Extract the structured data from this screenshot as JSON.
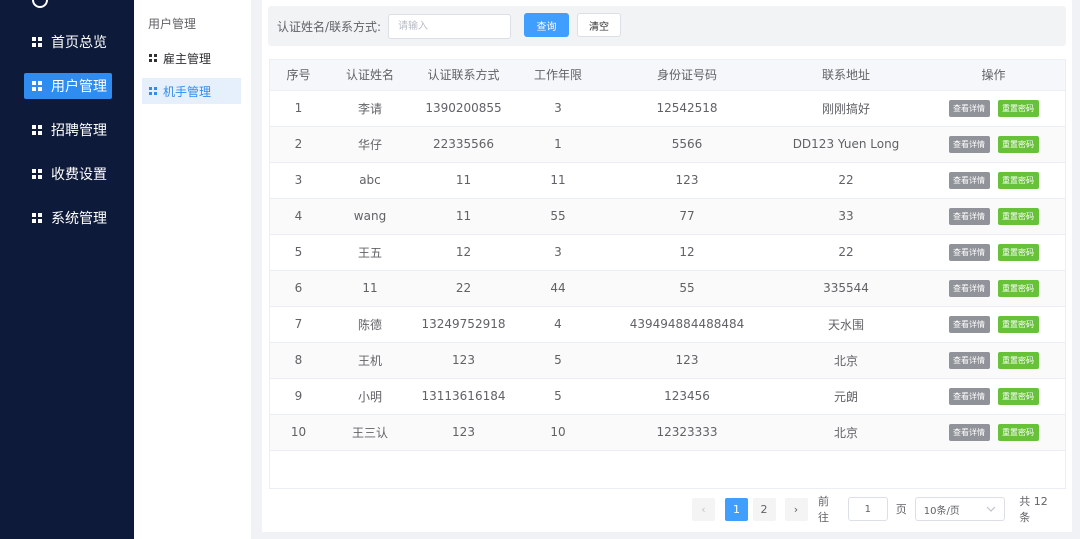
{
  "sidebar": {
    "items": [
      {
        "label": "首页总览",
        "active": false
      },
      {
        "label": "用户管理",
        "active": true
      },
      {
        "label": "招聘管理",
        "active": false
      },
      {
        "label": "收费设置",
        "active": false
      },
      {
        "label": "系统管理",
        "active": false
      }
    ]
  },
  "subnav": {
    "title": "用户管理",
    "items": [
      {
        "label": "雇主管理",
        "active": false
      },
      {
        "label": "机手管理",
        "active": true
      }
    ]
  },
  "search": {
    "label": "认证姓名/联系方式:",
    "placeholder": "请输入",
    "value": "",
    "query_label": "查询",
    "clear_label": "清空"
  },
  "table": {
    "columns": [
      "序号",
      "认证姓名",
      "认证联系方式",
      "工作年限",
      "身份证号码",
      "联系地址",
      "操作"
    ],
    "actions": {
      "view_label": "查看详情",
      "reset_label": "重置密码"
    },
    "rows": [
      {
        "no": "1",
        "name": "李请",
        "phone": "1390200855",
        "years": "3",
        "id_card": "12542518",
        "address": "刚刚搞好"
      },
      {
        "no": "2",
        "name": "华仔",
        "phone": "22335566",
        "years": "1",
        "id_card": "5566",
        "address": "DD123 Yuen Long"
      },
      {
        "no": "3",
        "name": "abc",
        "phone": "11",
        "years": "11",
        "id_card": "123",
        "address": "22"
      },
      {
        "no": "4",
        "name": "wang",
        "phone": "11",
        "years": "55",
        "id_card": "77",
        "address": "33"
      },
      {
        "no": "5",
        "name": "王五",
        "phone": "12",
        "years": "3",
        "id_card": "12",
        "address": "22"
      },
      {
        "no": "6",
        "name": "11",
        "phone": "22",
        "years": "44",
        "id_card": "55",
        "address": "335544"
      },
      {
        "no": "7",
        "name": "陈德",
        "phone": "13249752918",
        "years": "4",
        "id_card": "439494884488484",
        "address": "天水围"
      },
      {
        "no": "8",
        "name": "王机",
        "phone": "123",
        "years": "5",
        "id_card": "123",
        "address": "北京"
      },
      {
        "no": "9",
        "name": "小明",
        "phone": "13113616184",
        "years": "5",
        "id_card": "123456",
        "address": "元朗"
      },
      {
        "no": "10",
        "name": "王三认",
        "phone": "123",
        "years": "10",
        "id_card": "12323333",
        "address": "北京"
      }
    ]
  },
  "pagination": {
    "prev": "‹",
    "next": "›",
    "pages": [
      "1",
      "2"
    ],
    "current": "1",
    "goto_prefix": "前往",
    "goto_value": "1",
    "goto_suffix": "页",
    "page_size": "10条/页",
    "dropdown_icon": "chevron-down-icon",
    "total": "共 12 条"
  },
  "colors": {
    "sidebar_bg": "#0d1a3a",
    "accent": "#409eff",
    "view_button": "#909399",
    "reset_button": "#67c23a"
  }
}
